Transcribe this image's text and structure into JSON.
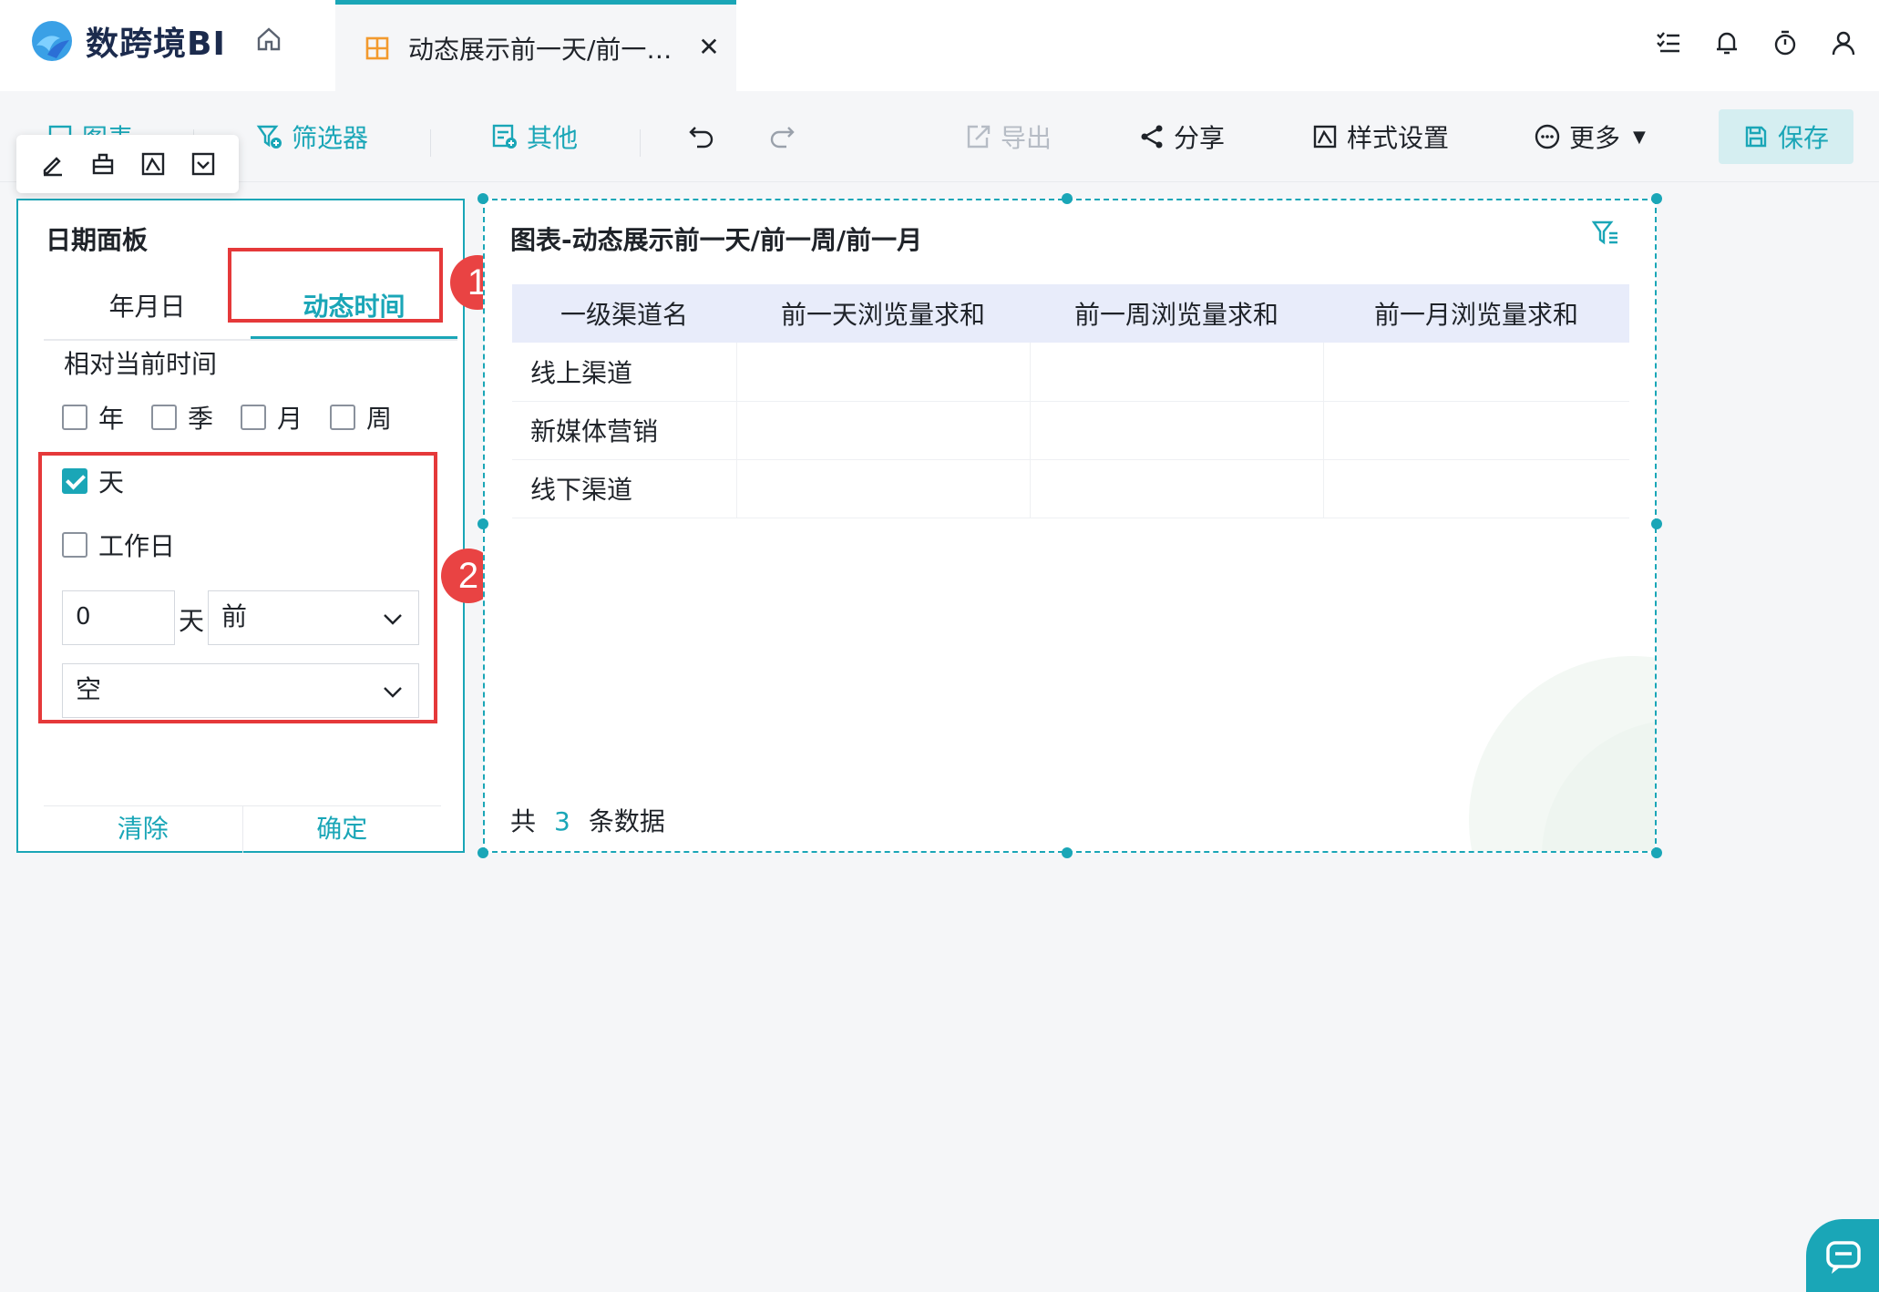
{
  "app": {
    "name": "数跨境BI"
  },
  "tab": {
    "title": "动态展示前一天/前一…"
  },
  "toolbar": {
    "chart_label": "图表",
    "filter_label": "筛选器",
    "other_label": "其他",
    "export_label": "导出",
    "share_label": "分享",
    "style_label": "样式设置",
    "more_label": "更多",
    "save_label": "保存"
  },
  "date_panel": {
    "title": "日期面板",
    "tabs": [
      "年月日",
      "动态时间"
    ],
    "active_tab": "动态时间",
    "relative_label": "相对当前时间",
    "checkboxes": [
      {
        "label": "年",
        "checked": false
      },
      {
        "label": "季",
        "checked": false
      },
      {
        "label": "月",
        "checked": false
      },
      {
        "label": "周",
        "checked": false
      },
      {
        "label": "天",
        "checked": true
      },
      {
        "label": "工作日",
        "checked": false
      }
    ],
    "offset_value": "0",
    "offset_unit": "天",
    "direction_select": "前",
    "extra_select": "空",
    "clear_label": "清除",
    "confirm_label": "确定"
  },
  "annotations": {
    "badge1": "1",
    "badge2": "2"
  },
  "chart": {
    "title": "图表-动态展示前一天/前一周/前一月",
    "columns": [
      "一级渠道名",
      "前一天浏览量求和",
      "前一周浏览量求和",
      "前一月浏览量求和"
    ],
    "rows": [
      [
        "线上渠道",
        "",
        "",
        ""
      ],
      [
        "新媒体营销",
        "",
        "",
        ""
      ],
      [
        "线下渠道",
        "",
        "",
        ""
      ]
    ],
    "footer_prefix": "共",
    "footer_count": "3",
    "footer_suffix": "条数据"
  },
  "colors": {
    "accent": "#1aa6b7",
    "annotation_red": "#e5393a",
    "header_bg": "#e8ecfa"
  }
}
